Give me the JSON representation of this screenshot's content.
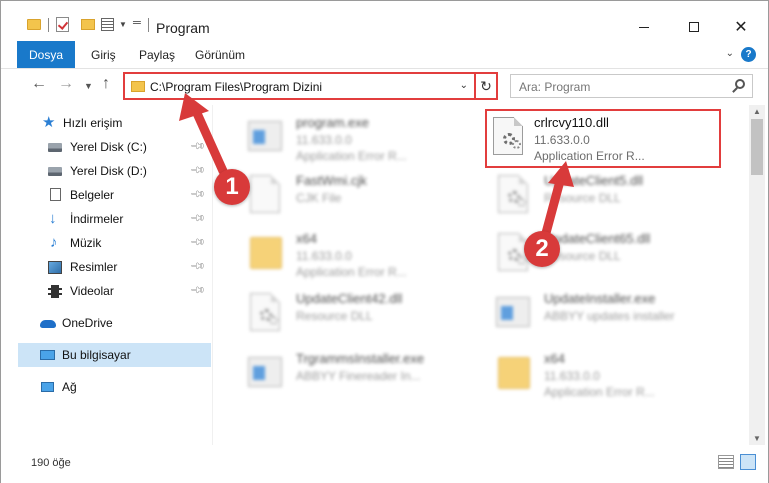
{
  "window": {
    "title": "Program"
  },
  "ribbon": {
    "tabs": [
      "Dosya",
      "Giriş",
      "Paylaş",
      "Görünüm"
    ],
    "active_tab": "Dosya",
    "accent_color": "#1979ca"
  },
  "address": {
    "path": "C:\\Program Files\\Program Dizini"
  },
  "search": {
    "placeholder": "Ara: Program"
  },
  "sidebar": {
    "items": [
      {
        "label": "Hızlı erişim",
        "icon": "star-icon"
      },
      {
        "label": "Yerel Disk (C:)",
        "icon": "disk-icon",
        "pinned": true
      },
      {
        "label": "Yerel Disk (D:)",
        "icon": "disk-icon",
        "pinned": true
      },
      {
        "label": "Belgeler",
        "icon": "document-icon",
        "pinned": true
      },
      {
        "label": "İndirmeler",
        "icon": "download-icon",
        "pinned": true
      },
      {
        "label": "Müzik",
        "icon": "music-icon",
        "pinned": true
      },
      {
        "label": "Resimler",
        "icon": "pictures-icon",
        "pinned": true
      },
      {
        "label": "Videolar",
        "icon": "video-icon",
        "pinned": true
      },
      {
        "label": "OneDrive",
        "icon": "cloud-icon"
      },
      {
        "label": "Bu bilgisayar",
        "icon": "computer-icon",
        "selected": true
      },
      {
        "label": "Ağ",
        "icon": "network-icon"
      }
    ]
  },
  "files": [
    {
      "name": "program.exe",
      "line2": "11.633.0.0",
      "line3": "Application Error R...",
      "icon": "exe-icon"
    },
    {
      "name": "crlrcvy110.dll",
      "line2": "11.633.0.0",
      "line3": "Application Error R...",
      "icon": "dll-icon",
      "highlighted": true
    },
    {
      "name": "FastWmi.cjk",
      "line2": "CJK File",
      "line3": "",
      "icon": "file-icon"
    },
    {
      "name": "UpdateClient5.dll",
      "line2": "Resource DLL",
      "line3": "",
      "icon": "dll-icon"
    },
    {
      "name": "x64",
      "line2": "11.633.0.0",
      "line3": "Application Error R...",
      "icon": "folder-icon"
    },
    {
      "name": "UpdateClient65.dll",
      "line2": "Resource DLL",
      "line3": "",
      "icon": "dll-icon"
    },
    {
      "name": "UpdateClient42.dll",
      "line2": "Resource DLL",
      "line3": "",
      "icon": "dll-icon"
    },
    {
      "name": "UpdateInstaller.exe",
      "line2": "ABBYY updates installer",
      "line3": "",
      "icon": "exe-icon"
    },
    {
      "name": "TrgrammsInstaller.exe",
      "line2": "ABBYY Finereader In...",
      "line3": "",
      "icon": "exe-icon"
    },
    {
      "name": "x64",
      "line2": "11.633.0.0",
      "line3": "Application Error R...",
      "icon": "folder-icon"
    }
  ],
  "status": {
    "item_count": "190 öğe"
  },
  "annotations": {
    "badge_1": "1",
    "badge_2": "2",
    "color": "#d83a3a"
  }
}
